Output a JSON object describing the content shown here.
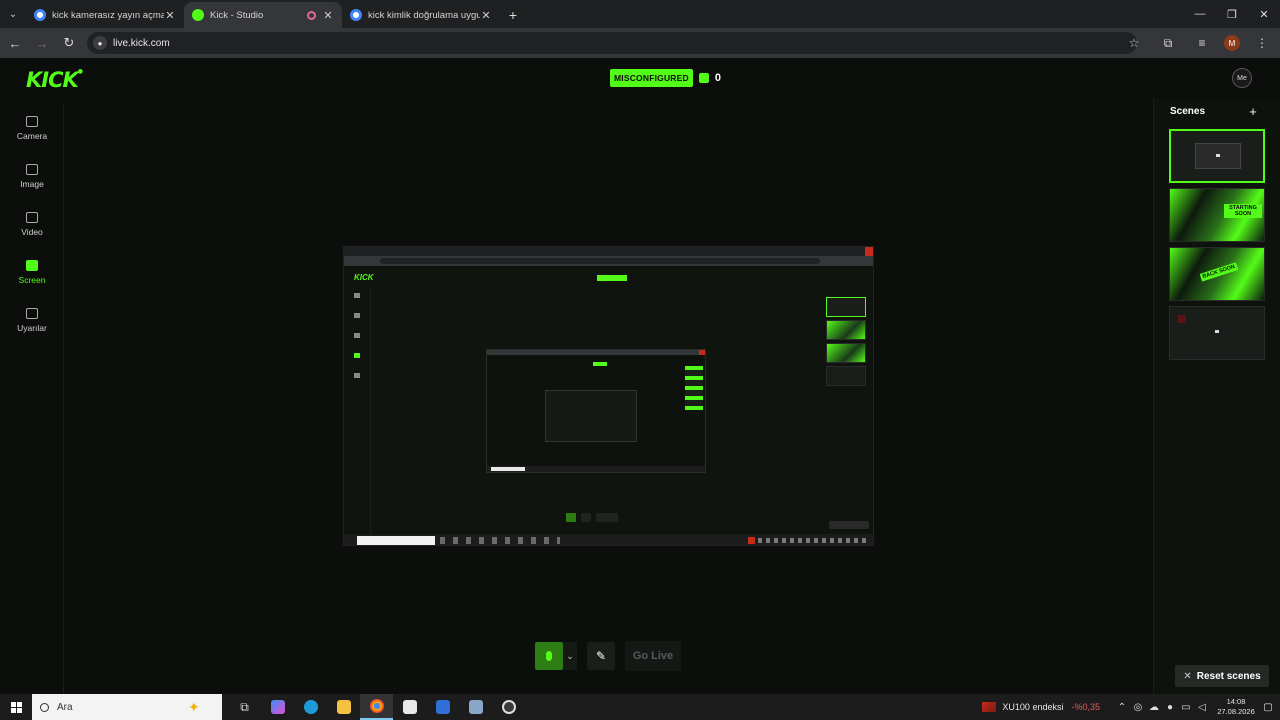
{
  "browser": {
    "tabs": [
      {
        "label": "kick kamerasız yayın açma - Go",
        "favicon": "google-icon",
        "active": false
      },
      {
        "label": "Kick - Studio",
        "favicon": "kick-icon",
        "active": true
      },
      {
        "label": "kick kimlik doğrulama uygulam",
        "favicon": "google-icon",
        "active": false
      }
    ],
    "url": "live.kick.com",
    "profile_initial": "M"
  },
  "studio": {
    "logo": "KICK",
    "status_badge": "MISCONFIGURED",
    "viewer_count": "0",
    "user_avatar_text": "Me",
    "sidebar": [
      {
        "label": "Camera",
        "icon": "camera-icon",
        "active": false
      },
      {
        "label": "Image",
        "icon": "image-icon",
        "active": false
      },
      {
        "label": "Video",
        "icon": "film-icon",
        "active": false
      },
      {
        "label": "Screen",
        "icon": "screen-icon",
        "active": true
      },
      {
        "label": "Uyarılar",
        "icon": "party-icon",
        "active": false
      }
    ],
    "controls": {
      "golive": "Go Live"
    },
    "scenes": {
      "title": "Scenes",
      "cards": [
        {
          "tag": ""
        },
        {
          "tag": "STARTING SOON"
        },
        {
          "tag": "BACK SOON"
        },
        {
          "tag": ""
        }
      ],
      "reset": "Reset scenes"
    }
  },
  "taskbar": {
    "search_placeholder": "Ara",
    "stock_name": "XU100 endeksi",
    "stock_change": "-%0,35",
    "time": "14:08",
    "date": "27.08.2026"
  },
  "colors": {
    "accent": "#53fc18",
    "background": "#0b0e0b",
    "close_red": "#c42b1c"
  }
}
